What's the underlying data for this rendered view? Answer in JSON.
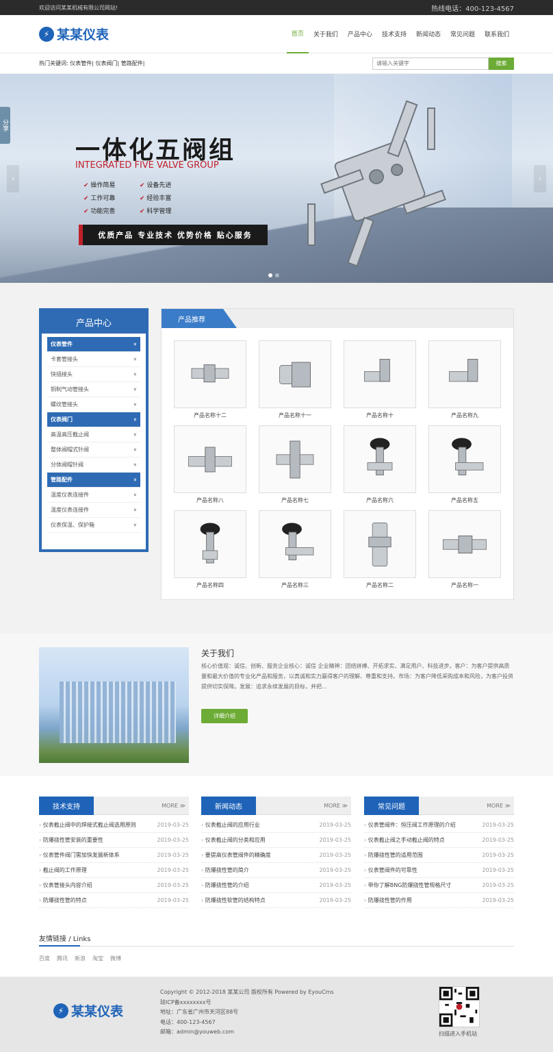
{
  "topbar": {
    "welcome": "欢迎访问某某机械有限公司网站!",
    "hotline": "热线电话：400-123-4567"
  },
  "brand": {
    "name": "某某仪表",
    "color": "#1e63b8",
    "accent": "#6cab35"
  },
  "nav": [
    "首页",
    "关于我们",
    "产品中心",
    "技术支持",
    "新闻动态",
    "常见问题",
    "联系我们"
  ],
  "search": {
    "keywords": "热门关键词:   仪表管件| 仪表阀门| 管路配件|",
    "placeholder": "请输入关键字",
    "button": "搜索"
  },
  "banner": {
    "title": "一体化五阀组",
    "subtitle": "INTEGRATED FIVE VALVE GROUP",
    "features": [
      "操作简易",
      "设备先进",
      "工作可靠",
      "经验丰富",
      "功能完善",
      "科学管理"
    ],
    "slogan": "优质产品  专业技术  优势价格  贴心服务",
    "share": "分享"
  },
  "sidebar": {
    "title": "产品中心",
    "items": [
      {
        "label": "仪表管件",
        "cat": true
      },
      {
        "label": "卡套管接头"
      },
      {
        "label": "快插接头"
      },
      {
        "label": "铜制气动管接头"
      },
      {
        "label": "螺纹管接头"
      },
      {
        "label": "仪表阀门",
        "cat": true
      },
      {
        "label": "高温高压截止阀"
      },
      {
        "label": "整体阀帽式针阀"
      },
      {
        "label": "分体阀帽针阀"
      },
      {
        "label": "管路配件",
        "cat": true
      },
      {
        "label": "温度仪表连接件"
      },
      {
        "label": "温度仪表连接件"
      },
      {
        "label": "仪表保温、保护箱"
      }
    ]
  },
  "products": {
    "title": "产品推荐",
    "items": [
      "产品名称十二",
      "产品名称十一",
      "产品名称十",
      "产品名称九",
      "产品名称八",
      "产品名称七",
      "产品名称六",
      "产品名称五",
      "产品名称四",
      "产品名称三",
      "产品名称二",
      "产品名称一"
    ]
  },
  "about": {
    "title": "关于我们",
    "text": "核心价值观：诚信、创新、服务企业核心：诚信 企业精神：团结拼搏、开拓求实、满足用户、科技进步。客户：为客户提供高质量和最大价值的专业化产品和服务，以真诚和实力赢得客户的理解、尊重和支持。市场：为客户降低采购成本和风险，为客户投资提供切实保障。发展：追求永续发展的目标，并把...",
    "button": "详细介绍"
  },
  "columns": [
    {
      "title": "技术支持",
      "more": "MORE ≫",
      "items": [
        {
          "t": "仪表截止阀中的焊接式截止阀选用原则",
          "d": "2019-03-25"
        },
        {
          "t": "防爆挠性管安装的重要性",
          "d": "2019-03-25"
        },
        {
          "t": "仪表管件阀门需加快发展新体系",
          "d": "2019-03-25"
        },
        {
          "t": "截止阀的工作原理",
          "d": "2019-03-25"
        },
        {
          "t": "仪表管接头内容介绍",
          "d": "2019-03-25"
        },
        {
          "t": "防爆挠性管的特点",
          "d": "2019-03-25"
        }
      ]
    },
    {
      "title": "新闻动态",
      "more": "MORE ≫",
      "items": [
        {
          "t": "仪表截止阀的应用行业",
          "d": "2019-03-25"
        },
        {
          "t": "仪表截止阀的分类和应用",
          "d": "2019-03-25"
        },
        {
          "t": "要提高仪表管阀件的精确度",
          "d": "2019-03-25"
        },
        {
          "t": "防爆挠性管的简介",
          "d": "2019-03-25"
        },
        {
          "t": "防爆挠性管的介绍",
          "d": "2019-03-25"
        },
        {
          "t": "防爆挠性软管的结构特点",
          "d": "2019-03-25"
        }
      ]
    },
    {
      "title": "常见问题",
      "more": "MORE ≫",
      "items": [
        {
          "t": "仪表管阀件：恒压阀工作原理的介绍",
          "d": "2019-03-25"
        },
        {
          "t": "仪表截止阀之手动截止阀的特点",
          "d": "2019-03-25"
        },
        {
          "t": "防爆挠性管的适用范围",
          "d": "2019-03-25"
        },
        {
          "t": "仪表管阀件的可靠性",
          "d": "2019-03-25"
        },
        {
          "t": "带你了解BNG防爆挠性管规格尺寸",
          "d": "2019-03-25"
        },
        {
          "t": "防爆挠性管的作用",
          "d": "2019-03-25"
        }
      ]
    }
  ],
  "links": {
    "title": "友情链接 / Links",
    "items": [
      "百度",
      "腾讯",
      "新浪",
      "淘宝",
      "微博"
    ]
  },
  "footer": {
    "copyright": "Copyright © 2012-2018 某某公司 版权所有 Powered by EyouCms",
    "icp": "琼ICP备xxxxxxxx号",
    "address": "地址：广东省广州市天河区88号",
    "phone": "电话：400-123-4567",
    "email": "邮箱：admin@youweb.com",
    "qr_text": "扫描进入手机站"
  }
}
